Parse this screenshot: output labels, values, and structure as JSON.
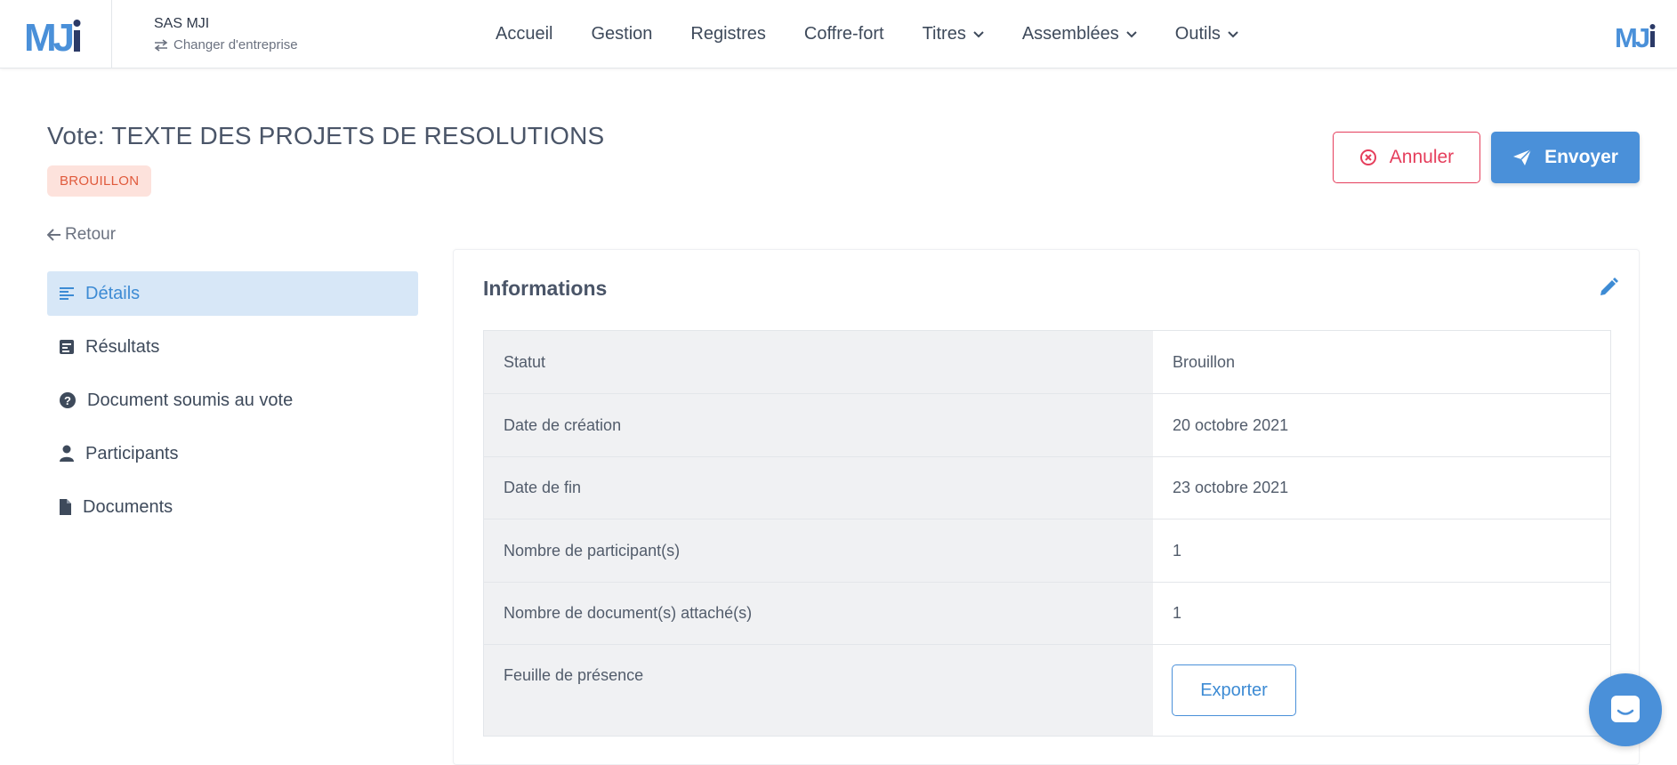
{
  "brand": {
    "logo_text": "MJi",
    "accent": "#4a90d9",
    "danger": "#e53e5c"
  },
  "company": {
    "name": "SAS MJI",
    "switch_label": "Changer d'entreprise"
  },
  "nav": {
    "items": [
      {
        "label": "Accueil",
        "dropdown": false
      },
      {
        "label": "Gestion",
        "dropdown": false
      },
      {
        "label": "Registres",
        "dropdown": false
      },
      {
        "label": "Coffre-fort",
        "dropdown": false
      },
      {
        "label": "Titres",
        "dropdown": true
      },
      {
        "label": "Assemblées",
        "dropdown": true
      },
      {
        "label": "Outils",
        "dropdown": true
      }
    ]
  },
  "page": {
    "title": "Vote: TEXTE DES PROJETS DE RESOLUTIONS",
    "status_badge": "BROUILLON",
    "back_label": "Retour",
    "cancel_label": "Annuler",
    "send_label": "Envoyer"
  },
  "side": {
    "items": [
      {
        "label": "Détails",
        "icon": "align-left-icon",
        "active": true
      },
      {
        "label": "Résultats",
        "icon": "poll-icon",
        "active": false
      },
      {
        "label": "Document soumis au vote",
        "icon": "question-circle-icon",
        "active": false
      },
      {
        "label": "Participants",
        "icon": "user-icon",
        "active": false
      },
      {
        "label": "Documents",
        "icon": "file-icon",
        "active": false
      }
    ]
  },
  "info": {
    "title": "Informations",
    "rows": [
      {
        "label": "Statut",
        "value": "Brouillon"
      },
      {
        "label": "Date de création",
        "value": "20 octobre 2021"
      },
      {
        "label": "Date de fin",
        "value": "23 octobre 2021"
      },
      {
        "label": "Nombre de participant(s)",
        "value": "1"
      },
      {
        "label": "Nombre de document(s) attaché(s)",
        "value": "1"
      },
      {
        "label": "Feuille de présence",
        "button": "Exporter"
      }
    ]
  }
}
